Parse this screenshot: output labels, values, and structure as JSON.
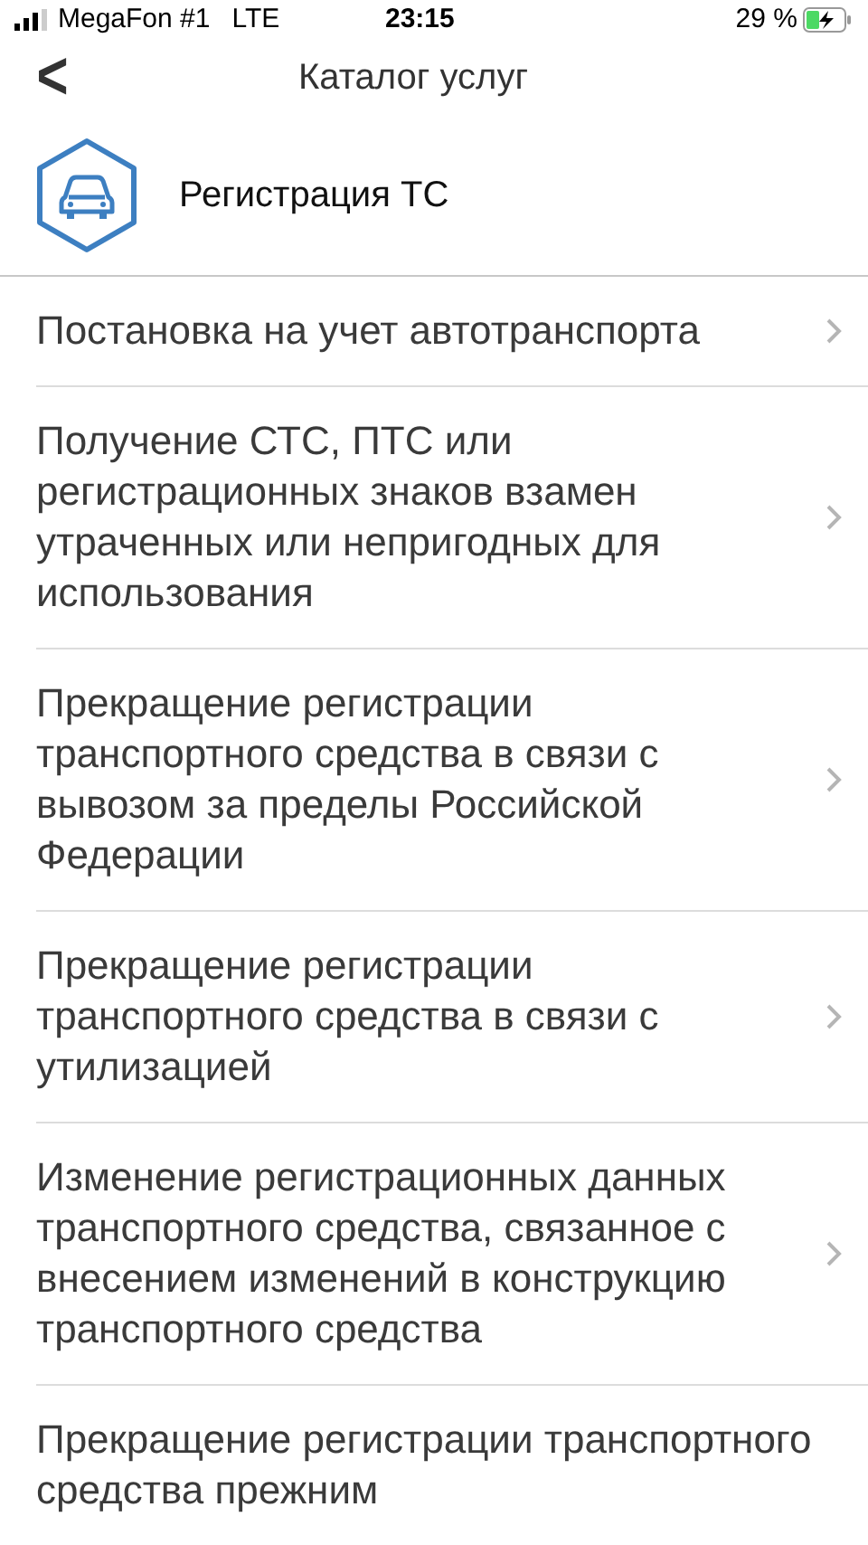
{
  "status_bar": {
    "carrier": "MegaFon #1",
    "network": "LTE",
    "time": "23:15",
    "battery": "29 %"
  },
  "nav": {
    "back": "<",
    "title": "Каталог услуг"
  },
  "category": {
    "title": "Регистрация ТС"
  },
  "services": [
    {
      "label": "Постановка на учет автотранспорта",
      "chevron": true
    },
    {
      "label": "Получение СТС, ПТС или регистрационных знаков взамен утраченных или непригодных для использования",
      "chevron": true
    },
    {
      "label": "Прекращение регистрации транспортного средства в связи с вывозом за пределы Российской Федерации",
      "chevron": true
    },
    {
      "label": "Прекращение регистрации транспортного средства в связи с утилизацией",
      "chevron": true
    },
    {
      "label": "Изменение регистрационных данных транспортного средства, связанное с внесением изменений в конструкцию транспортного средства",
      "chevron": true
    },
    {
      "label": "Прекращение регистрации транспортного средства прежним",
      "chevron": false
    }
  ]
}
